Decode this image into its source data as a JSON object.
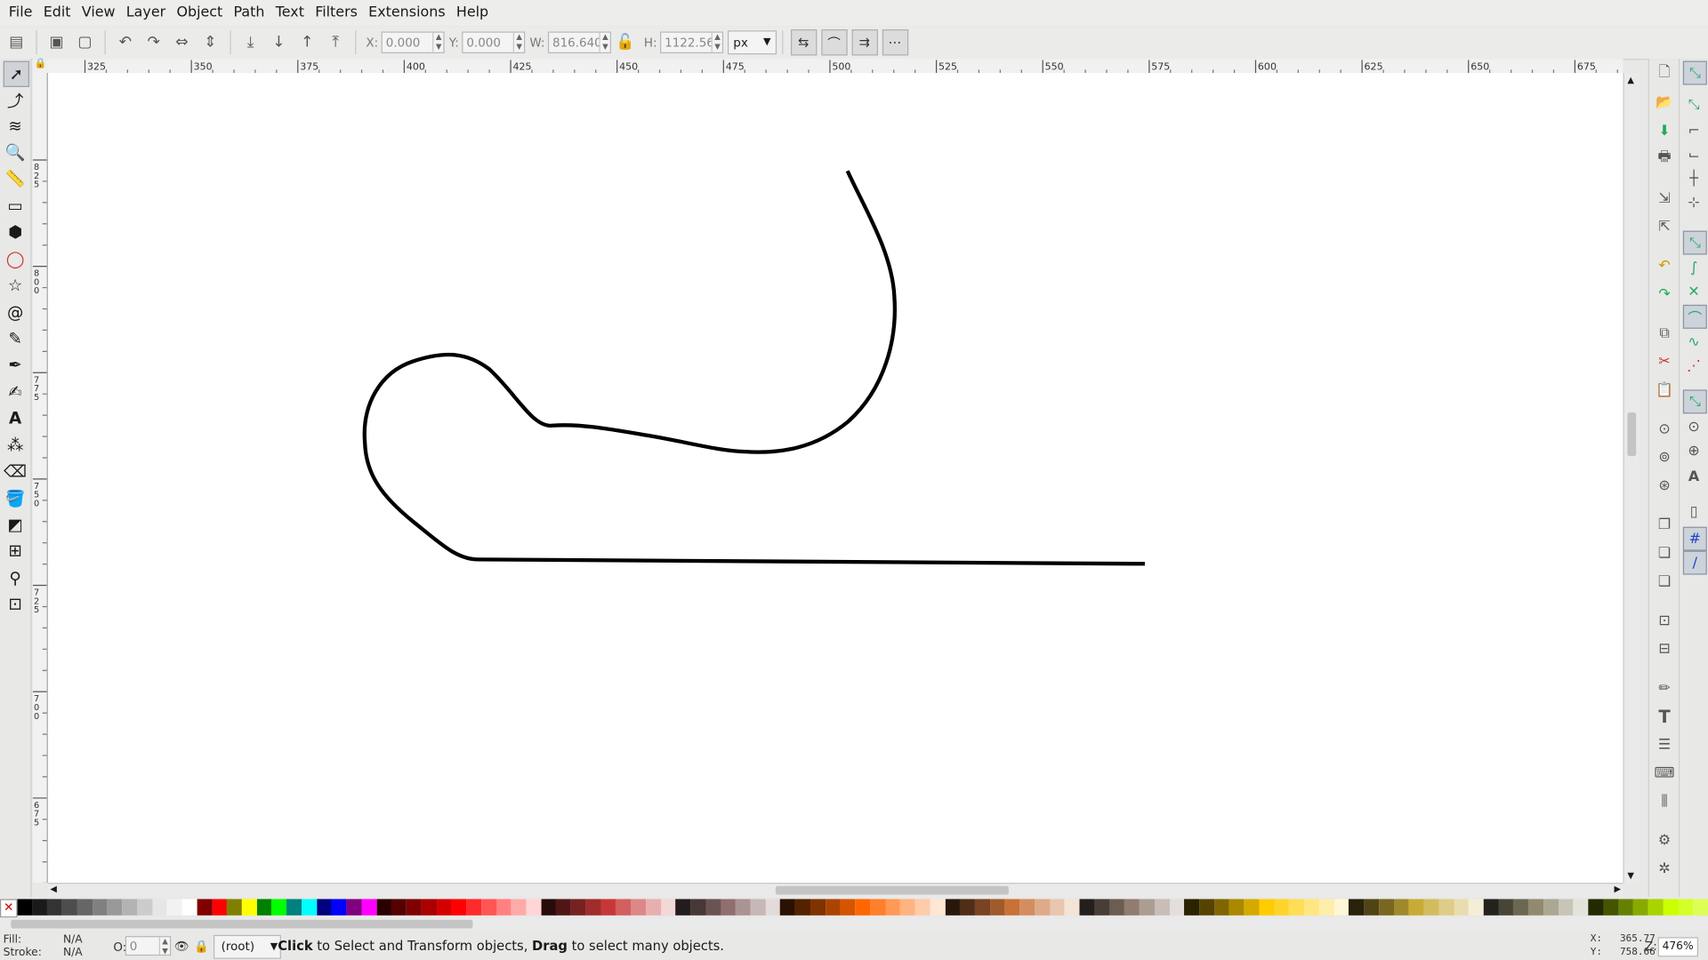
{
  "menu": [
    "File",
    "Edit",
    "View",
    "Layer",
    "Object",
    "Path",
    "Text",
    "Filters",
    "Extensions",
    "Help"
  ],
  "toolbar": {
    "x_label": "X:",
    "x_value": "0.000",
    "y_label": "Y:",
    "y_value": "0.000",
    "w_label": "W:",
    "w_value": "816.640",
    "h_label": "H:",
    "h_value": "1122.560",
    "unit": "px"
  },
  "rulers": {
    "h_ticks": [
      "325",
      "350",
      "375",
      "400",
      "425",
      "450",
      "475",
      "500",
      "525",
      "550",
      "575",
      "600",
      "625",
      "650",
      "675"
    ],
    "v_ticks": [
      "825",
      "800",
      "775",
      "750",
      "725",
      "700",
      "675"
    ]
  },
  "tools": [
    "select-tool",
    "node-tool",
    "tweak-tool",
    "zoom-tool",
    "measure-tool",
    "rect-tool",
    "3dbox-tool",
    "ellipse-tool",
    "star-tool",
    "spiral-tool",
    "pencil-tool",
    "pen-tool",
    "calligraphy-tool",
    "text-tool",
    "spray-tool",
    "eraser-tool",
    "bucket-tool",
    "gradient-tool",
    "mesh-tool",
    "dropper-tool",
    "connector-tool"
  ],
  "palette_colors": [
    "#000000",
    "#1a1a1a",
    "#333333",
    "#4d4d4d",
    "#666666",
    "#808080",
    "#999999",
    "#b3b3b3",
    "#cccccc",
    "#e6e6e6",
    "#f2f2f2",
    "#ffffff",
    "#800000",
    "#ff0000",
    "#808000",
    "#ffff00",
    "#008000",
    "#00ff00",
    "#008080",
    "#00ffff",
    "#000080",
    "#0000ff",
    "#800080",
    "#ff00ff",
    "#2b0000",
    "#550000",
    "#800000",
    "#aa0000",
    "#d40000",
    "#ff0000",
    "#ff2a2a",
    "#ff5555",
    "#ff8080",
    "#ffaaaa",
    "#ffd5d5",
    "#280b0b",
    "#501616",
    "#782121",
    "#a02c2c",
    "#c83737",
    "#d35f5f",
    "#de8787",
    "#e9afaf",
    "#f4d7d7",
    "#241c1c",
    "#483737",
    "#6c5353",
    "#916f6f",
    "#ac9393",
    "#c8b7b7",
    "#e3dbdb",
    "#2b1100",
    "#552200",
    "#803300",
    "#aa4400",
    "#d45500",
    "#ff6600",
    "#ff7f2a",
    "#ff9955",
    "#ffb380",
    "#ffccaa",
    "#ffe6d5",
    "#28170b",
    "#502d16",
    "#784421",
    "#a05a2c",
    "#c87137",
    "#d38d5f",
    "#deaa87",
    "#e9c6af",
    "#f4e3d7",
    "#241f1c",
    "#483e37",
    "#6c5d53",
    "#917c6f",
    "#ac9d93",
    "#c8beb7",
    "#e3dedb",
    "#2b2200",
    "#554400",
    "#806600",
    "#aa8800",
    "#d4aa00",
    "#ffcc00",
    "#ffd42a",
    "#ffdd55",
    "#ffe680",
    "#ffeeaa",
    "#fff6d5",
    "#28220b",
    "#504416",
    "#786721",
    "#a0892c",
    "#c8ab37",
    "#d3bc5f",
    "#decd87",
    "#e9ddaf",
    "#f4eed7",
    "#24221c",
    "#484537",
    "#6c6753",
    "#918a6f",
    "#aca793",
    "#c8c4b7",
    "#e3e2db",
    "#222b00",
    "#445500",
    "#668000",
    "#88aa00",
    "#aad400",
    "#ccff00",
    "#d4ff2a",
    "#ddff55"
  ],
  "status": {
    "fill_label": "Fill:",
    "fill_value": "N/A",
    "stroke_label": "Stroke:",
    "stroke_value": "N/A",
    "opacity_label": "O:",
    "opacity_value": "0",
    "layer": "(root)",
    "msg_click": "Click",
    "msg_mid": " to Select and Transform objects, ",
    "msg_drag": "Drag",
    "msg_end": " to select many objects.",
    "cursor_x": "X:   365.77",
    "cursor_y": "Y:   758.66",
    "zoom_label": "Z:",
    "zoom_value": "476%"
  }
}
